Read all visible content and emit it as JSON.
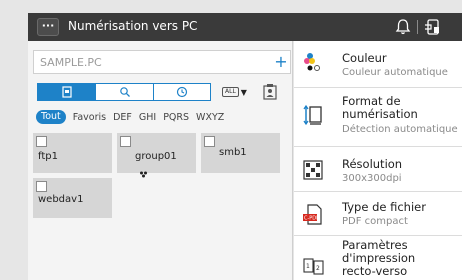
{
  "header": {
    "title": "Numérisation vers PC",
    "menu_label": "···"
  },
  "destination": {
    "placeholder": "SAMPLE.PC",
    "add_label": "+"
  },
  "view": {
    "all_label": "ALL"
  },
  "filters": [
    "Tout",
    "Favoris",
    "DEF",
    "GHI",
    "PQRS",
    "WXYZ"
  ],
  "destinations": [
    {
      "label": "ftp1",
      "group": false
    },
    {
      "label": "group01",
      "group": true
    },
    {
      "label": "smb1",
      "group": false
    },
    {
      "label": "webdav1",
      "group": false
    }
  ],
  "settings": [
    {
      "title": "Couleur",
      "value": "Couleur automatique",
      "icon": "color-icon"
    },
    {
      "title": "Format de numérisation",
      "value": "Détection automatique",
      "icon": "scan-size-icon"
    },
    {
      "title": "Résolution",
      "value": "300x300dpi",
      "icon": "resolution-icon"
    },
    {
      "title": "Type de fichier",
      "value": "PDF compact",
      "icon": "file-type-icon",
      "badge": "C-PDF"
    },
    {
      "title": "Paramètres d'impression recto-verso",
      "value": "",
      "icon": "duplex-icon"
    }
  ],
  "colors": {
    "accent": "#1e82c8",
    "header_bg": "#3a3a3a",
    "card_bg": "#d6d6d6"
  }
}
